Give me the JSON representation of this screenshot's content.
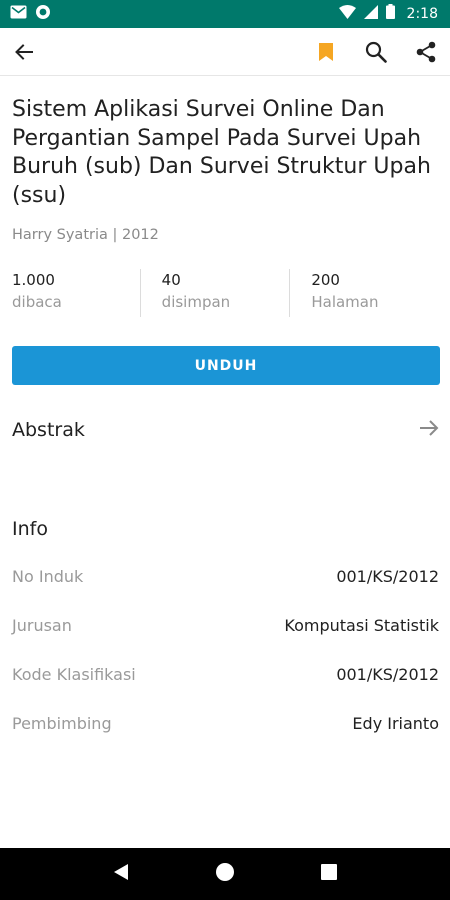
{
  "status_bar": {
    "time": "2:18",
    "icons": [
      "mail-icon",
      "circle-icon",
      "wifi-icon",
      "signal-icon",
      "battery-icon"
    ]
  },
  "app_bar": {
    "icons": [
      "back-arrow-icon",
      "bookmark-icon",
      "search-icon",
      "share-icon"
    ],
    "accent_color": "#f5a623"
  },
  "document": {
    "title": "Sistem Aplikasi Survei Online Dan Pergantian Sampel Pada Survei Upah Buruh (sub) Dan Survei Struktur Upah (ssu)",
    "author_year": "Harry Syatria | 2012",
    "stats": [
      {
        "value": "1.000",
        "label": "dibaca"
      },
      {
        "value": "40",
        "label": "disimpan"
      },
      {
        "value": "200",
        "label": "Halaman"
      }
    ],
    "download_label": "UNDUH",
    "download_color": "#1b95d6",
    "abstract_label": "Abstrak",
    "info_title": "Info",
    "info": [
      {
        "label": "No Induk",
        "value": "001/KS/2012"
      },
      {
        "label": "Jurusan",
        "value": "Komputasi Statistik"
      },
      {
        "label": "Kode Klasifikasi",
        "value": "001/KS/2012"
      },
      {
        "label": "Pembimbing",
        "value": "Edy Irianto"
      }
    ]
  },
  "nav_bar": {
    "icons": [
      "back-triangle-icon",
      "home-circle-icon",
      "recents-square-icon"
    ]
  }
}
